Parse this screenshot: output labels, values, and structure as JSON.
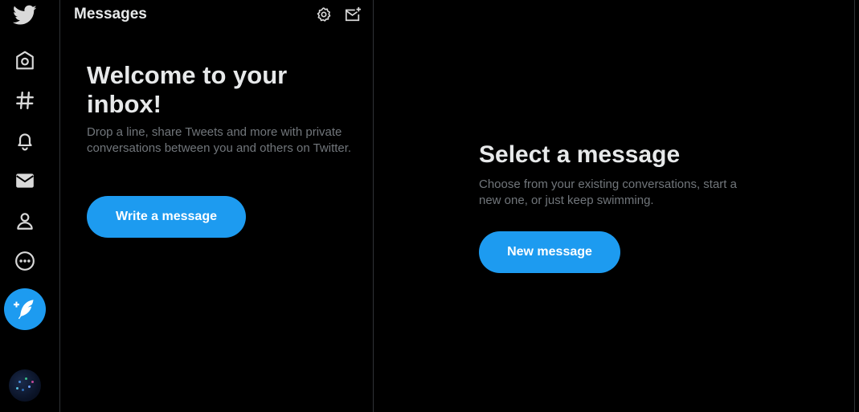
{
  "icons": {
    "logo": "twitter-bird-icon",
    "home": "home-icon",
    "explore": "hashtag-icon",
    "notifications": "bell-icon",
    "messages": "envelope-icon",
    "profile": "person-icon",
    "more": "more-circle-icon",
    "compose": "feather-plus-icon",
    "settings": "gear-icon",
    "new_message": "envelope-plus-icon"
  },
  "colors": {
    "accent": "#1d9bf0",
    "background": "#000000",
    "text_primary": "#e7e9ea",
    "text_secondary": "#71767b",
    "border": "#2f3336"
  },
  "messages": {
    "header_title": "Messages",
    "welcome_title": "Welcome to your inbox!",
    "welcome_description": "Drop a line, share Tweets and more with private conversations between you and others on Twitter.",
    "write_button_label": "Write a message"
  },
  "detail": {
    "title": "Select a message",
    "description": "Choose from your existing conversations, start a new one, or just keep swimming.",
    "new_message_button_label": "New message"
  }
}
